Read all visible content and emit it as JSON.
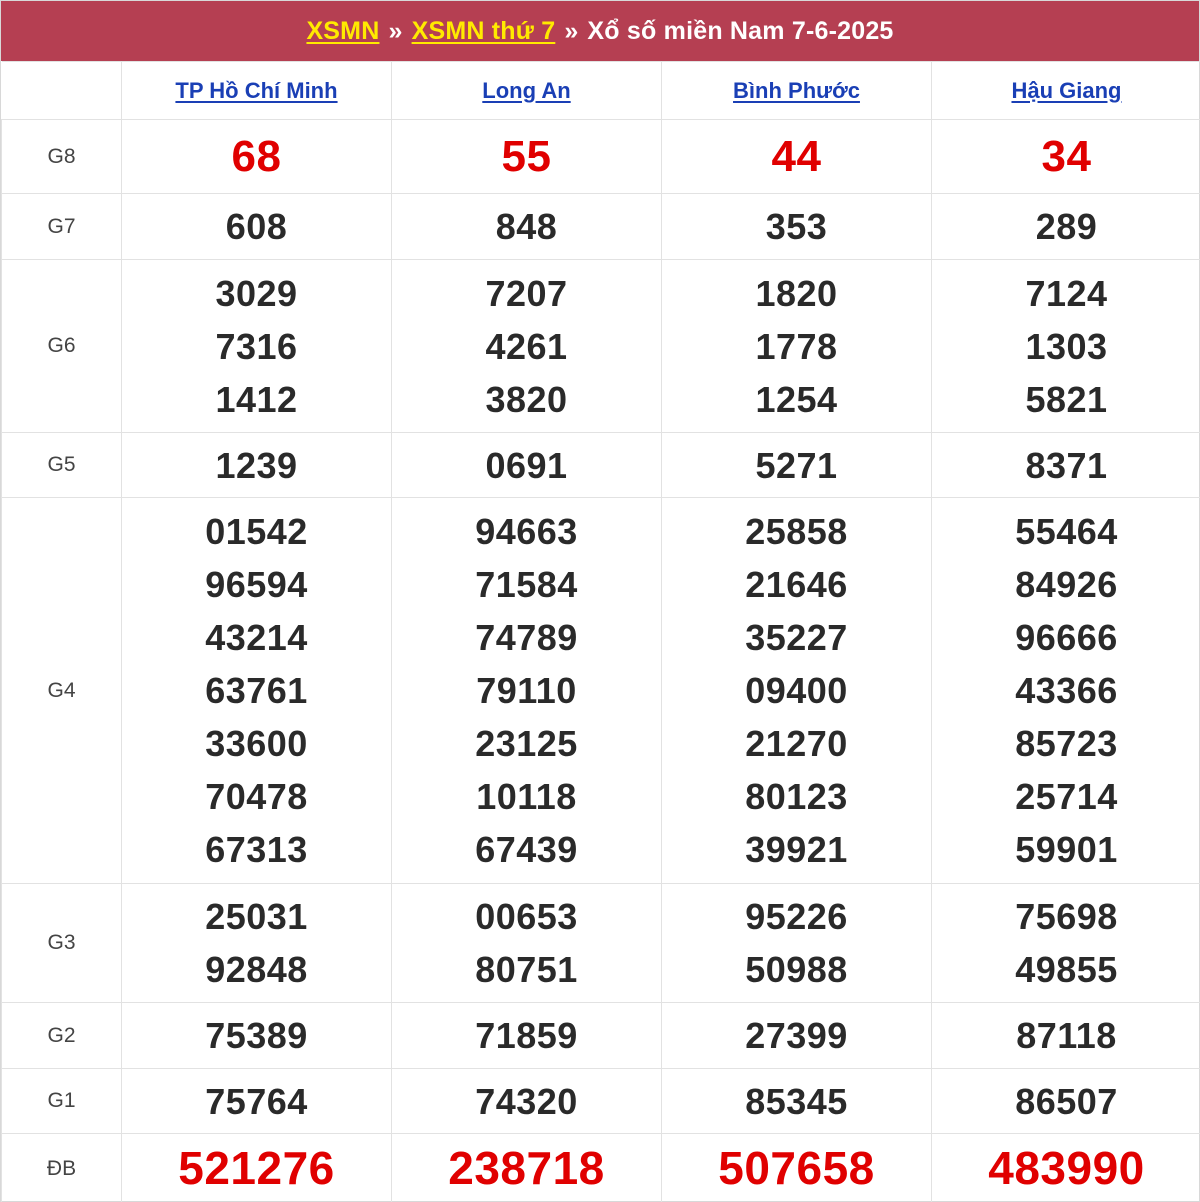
{
  "header": {
    "link1": "XSMN",
    "sep1": "»",
    "link2": "XSMN thứ 7",
    "sep2": "»",
    "title": "Xổ số miền Nam 7-6-2025"
  },
  "provinces": [
    "TP Hồ Chí Minh",
    "Long An",
    "Bình Phước",
    "Hậu Giang"
  ],
  "colors": {
    "title_bg": "#b53f52",
    "link_yellow": "#ffea00",
    "province_link": "#1a3fb5",
    "highlight_red": "#e00000"
  },
  "prizes": [
    {
      "label": "G8",
      "highlight": true,
      "results": [
        [
          "68"
        ],
        [
          "55"
        ],
        [
          "44"
        ],
        [
          "34"
        ]
      ]
    },
    {
      "label": "G7",
      "highlight": false,
      "results": [
        [
          "608"
        ],
        [
          "848"
        ],
        [
          "353"
        ],
        [
          "289"
        ]
      ]
    },
    {
      "label": "G6",
      "highlight": false,
      "results": [
        [
          "3029",
          "7316",
          "1412"
        ],
        [
          "7207",
          "4261",
          "3820"
        ],
        [
          "1820",
          "1778",
          "1254"
        ],
        [
          "7124",
          "1303",
          "5821"
        ]
      ]
    },
    {
      "label": "G5",
      "highlight": false,
      "results": [
        [
          "1239"
        ],
        [
          "0691"
        ],
        [
          "5271"
        ],
        [
          "8371"
        ]
      ]
    },
    {
      "label": "G4",
      "highlight": false,
      "results": [
        [
          "01542",
          "96594",
          "43214",
          "63761",
          "33600",
          "70478",
          "67313"
        ],
        [
          "94663",
          "71584",
          "74789",
          "79110",
          "23125",
          "10118",
          "67439"
        ],
        [
          "25858",
          "21646",
          "35227",
          "09400",
          "21270",
          "80123",
          "39921"
        ],
        [
          "55464",
          "84926",
          "96666",
          "43366",
          "85723",
          "25714",
          "59901"
        ]
      ]
    },
    {
      "label": "G3",
      "highlight": false,
      "results": [
        [
          "25031",
          "92848"
        ],
        [
          "00653",
          "80751"
        ],
        [
          "95226",
          "50988"
        ],
        [
          "75698",
          "49855"
        ]
      ]
    },
    {
      "label": "G2",
      "highlight": false,
      "results": [
        [
          "75389"
        ],
        [
          "71859"
        ],
        [
          "27399"
        ],
        [
          "87118"
        ]
      ]
    },
    {
      "label": "G1",
      "highlight": false,
      "results": [
        [
          "75764"
        ],
        [
          "74320"
        ],
        [
          "85345"
        ],
        [
          "86507"
        ]
      ]
    },
    {
      "label": "ĐB",
      "highlight": true,
      "results": [
        [
          "521276"
        ],
        [
          "238718"
        ],
        [
          "507658"
        ],
        [
          "483990"
        ]
      ]
    }
  ]
}
